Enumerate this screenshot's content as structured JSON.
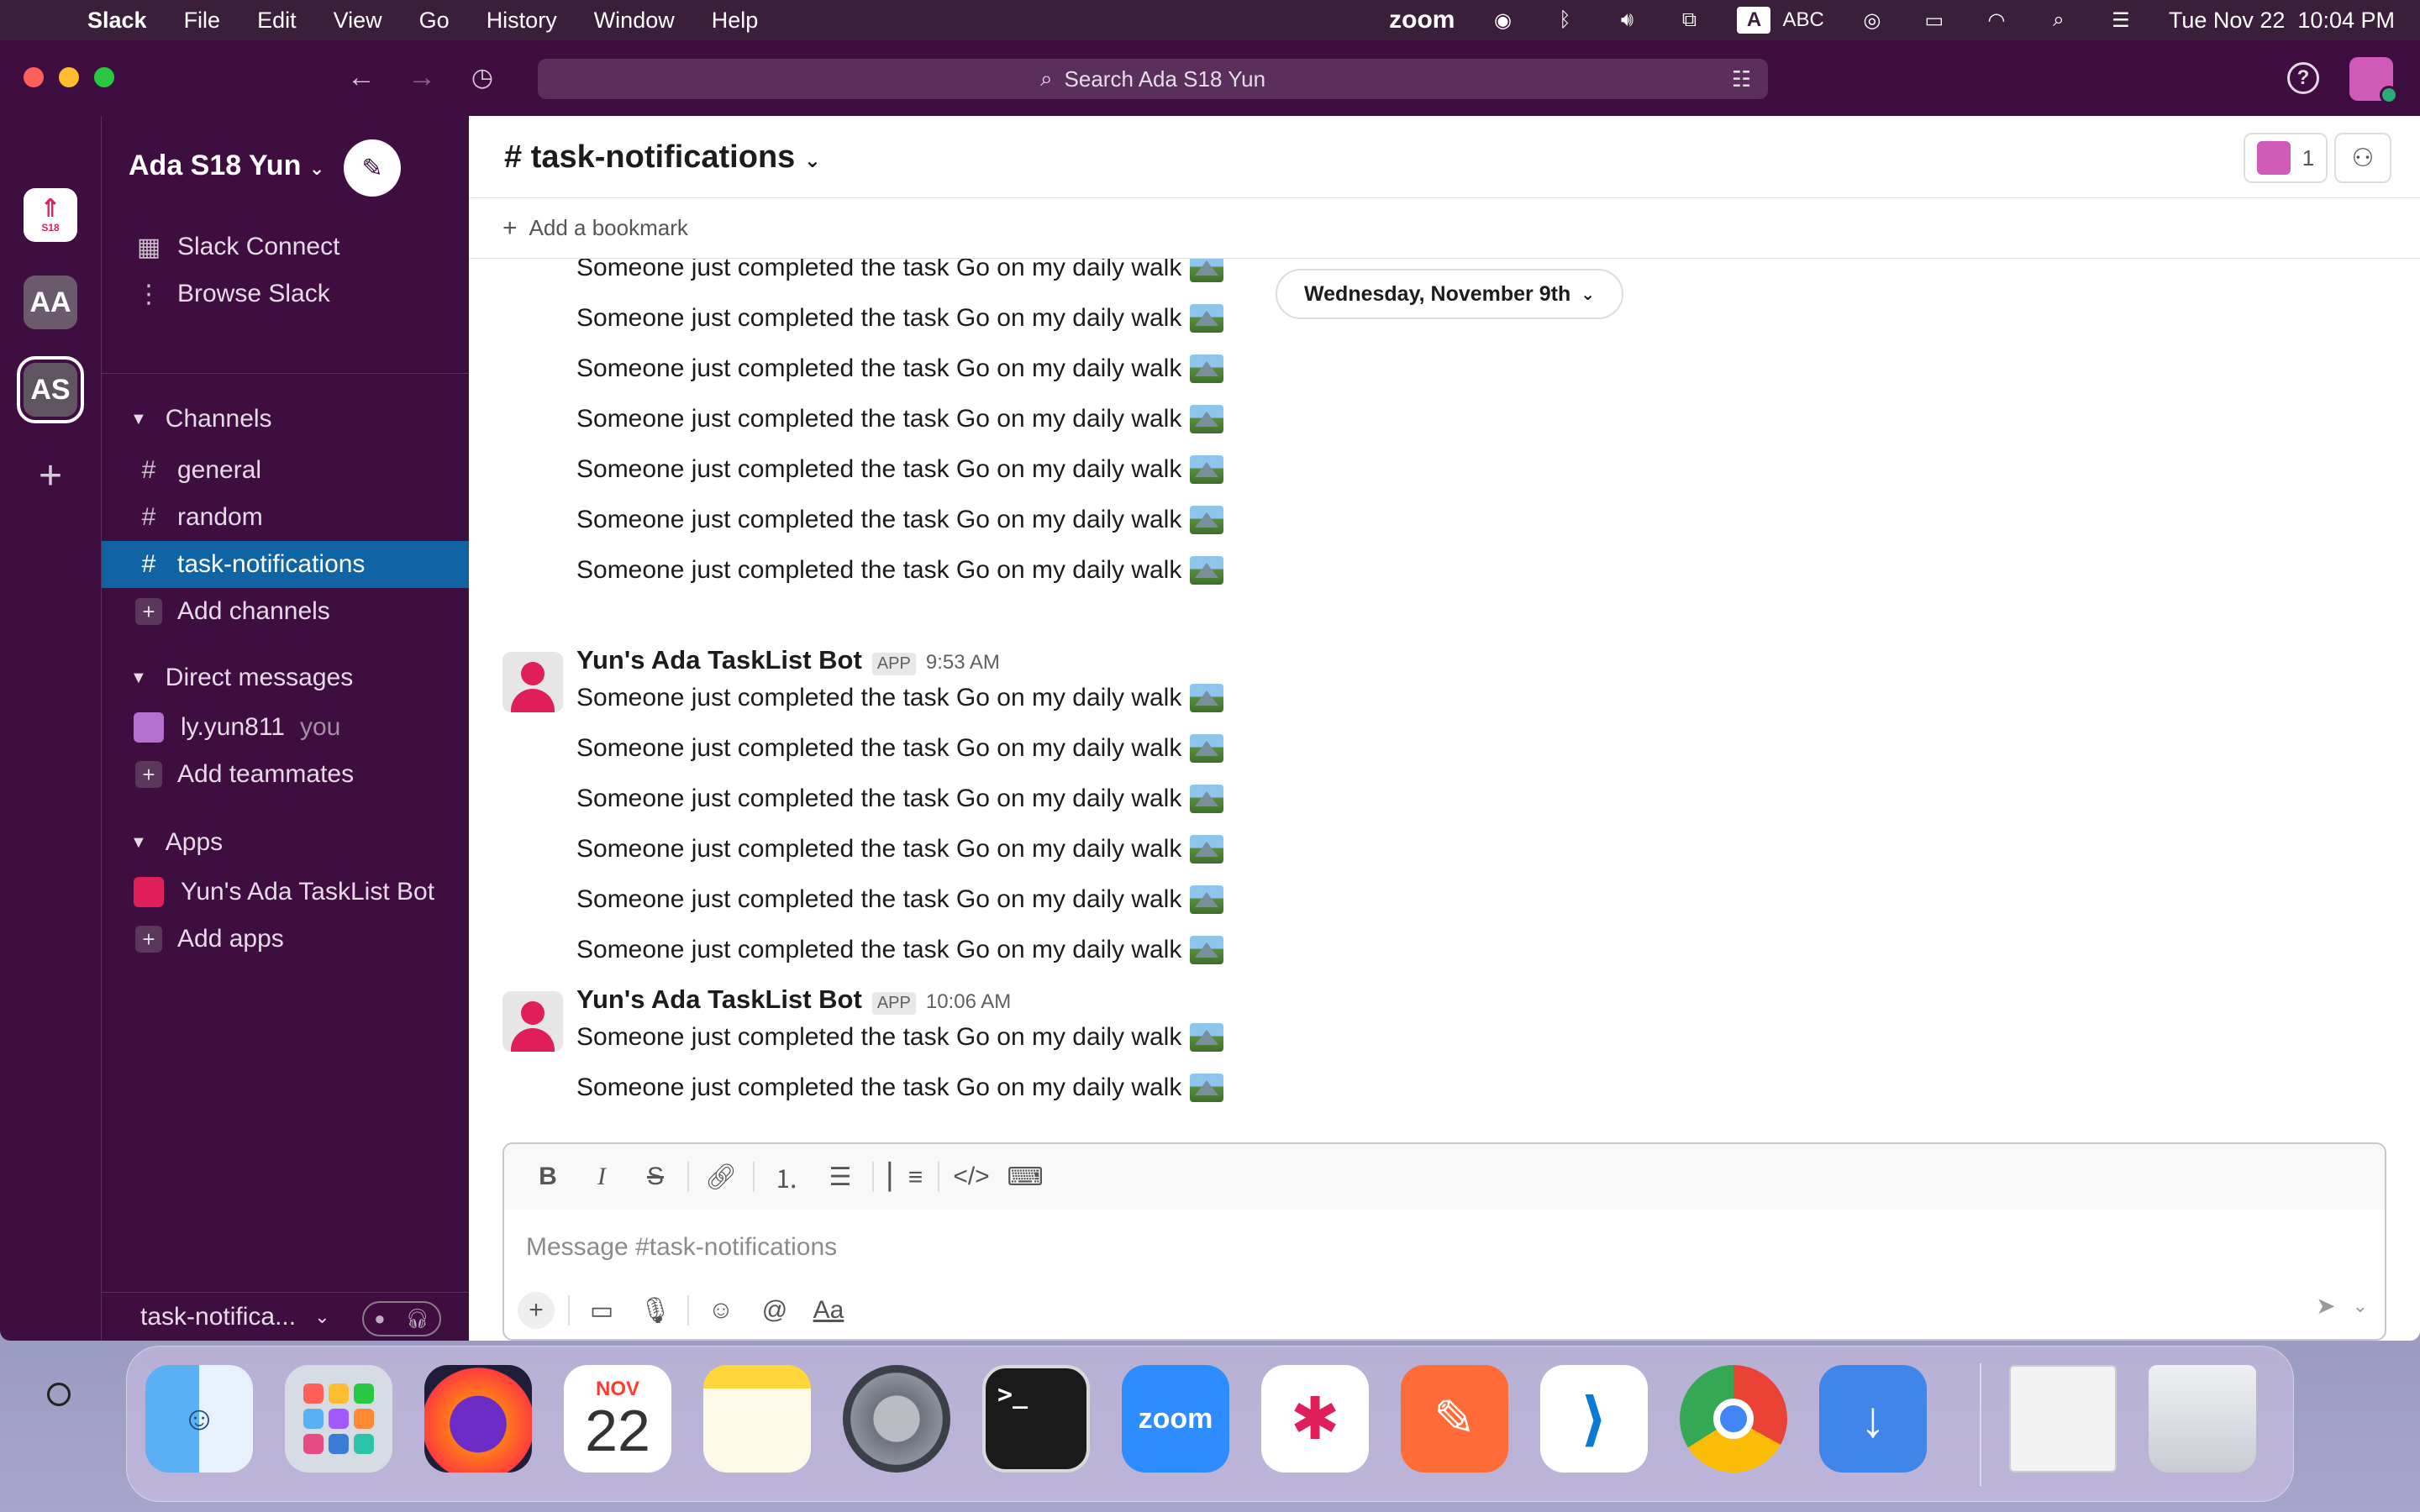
{
  "menubar": {
    "app_name": "Slack",
    "menus": [
      "File",
      "Edit",
      "View",
      "Go",
      "History",
      "Window",
      "Help"
    ],
    "zoom_label": "zoom",
    "input_source": "ABC",
    "input_badge": "A",
    "clock": "Tue Nov 22  10:04 PM"
  },
  "titlebar": {
    "search_placeholder": "Search Ada S18 Yun"
  },
  "rail": {
    "workspace_logo_text": "S18",
    "workspaces": [
      "AA",
      "AS"
    ]
  },
  "sidebar": {
    "workspace_name": "Ada S18 Yun",
    "top_items": [
      {
        "label": "Slack Connect",
        "icon": "building-icon"
      },
      {
        "label": "Browse Slack",
        "icon": "more-vertical-icon"
      }
    ],
    "channels_header": "Channels",
    "channels": [
      "general",
      "random",
      "task-notifications"
    ],
    "active_channel": "task-notifications",
    "add_channels": "Add channels",
    "dms_header": "Direct messages",
    "dm_user": "ly.yun811",
    "dm_you": "you",
    "add_teammates": "Add teammates",
    "apps_header": "Apps",
    "app_bot": "Yun's Ada TaskList Bot",
    "add_apps": "Add apps",
    "huddle_channel": "task-notifica..."
  },
  "channel": {
    "title": "# task-notifications",
    "member_count": "1",
    "add_bookmark": "Add a bookmark",
    "date_divider": "Wednesday, November 9th"
  },
  "messages": {
    "line_text": "Someone just completed the task Go on my daily walk",
    "first_group_lines": 7,
    "groups": [
      {
        "sender": "Yun's Ada TaskList Bot",
        "tag": "APP",
        "time": "9:53 AM",
        "line_count": 6
      },
      {
        "sender": "Yun's Ada TaskList Bot",
        "tag": "APP",
        "time": "10:06 AM",
        "line_count": 2
      }
    ]
  },
  "composer": {
    "placeholder": "Message #task-notifications",
    "format_buttons": [
      "bold-icon",
      "italic-icon",
      "strikethrough-icon",
      "link-icon",
      "ordered-list-icon",
      "bulleted-list-icon",
      "blockquote-icon",
      "code-icon",
      "code-block-icon"
    ],
    "bottom_buttons": [
      "plus-icon",
      "video-icon",
      "microphone-icon",
      "emoji-icon",
      "mention-icon",
      "formatting-icon"
    ]
  },
  "dock": {
    "calendar_month": "NOV",
    "calendar_day": "22",
    "zoom_label": "zoom",
    "apps": [
      "Finder",
      "Launchpad",
      "Firefox",
      "Calendar",
      "Notes",
      "System Preferences",
      "Terminal",
      "Zoom",
      "Slack",
      "Postman",
      "Visual Studio Code",
      "Google Chrome",
      "Downloads",
      "Preview",
      "Trash"
    ]
  },
  "colors": {
    "sidebar_bg": "#3f0e40",
    "active_item": "#1164a3",
    "bot_avatar": "#e01e5a"
  }
}
